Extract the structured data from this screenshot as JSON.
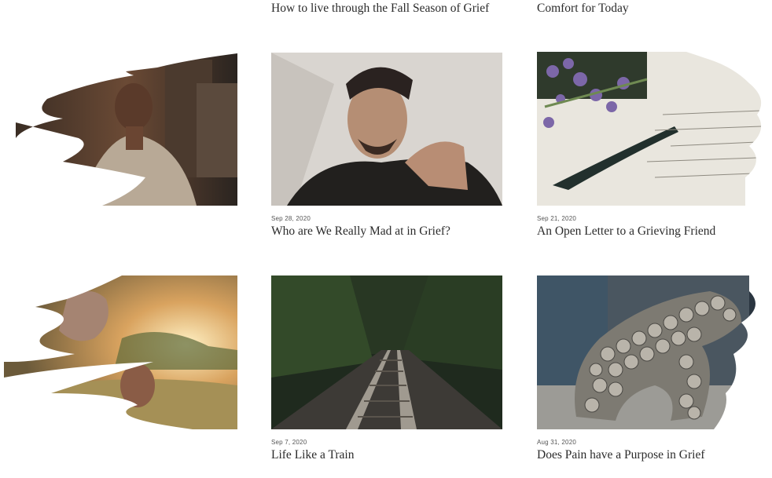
{
  "top_row": {
    "post_2_title": "How to live through the Fall Season of Grief",
    "post_3_title": "Comfort for Today"
  },
  "row_1": {
    "post_1": {
      "image_alt": "woman resting chin on hands"
    },
    "post_2": {
      "date": "Sep 28, 2020",
      "title": "Who are We Really Mad at in Grief?",
      "image_alt": "young man with shadowed face"
    },
    "post_3": {
      "date": "Sep 21, 2020",
      "title": "An Open Letter to a Grieving Friend",
      "image_alt": "fountain pen on handwritten letter with lavender"
    }
  },
  "row_2": {
    "post_1": {
      "image_alt": "person holding teddy bear in field at sunset"
    },
    "post_2": {
      "date": "Sep 7, 2020",
      "title": "Life Like a Train",
      "image_alt": "railway tracks through forest"
    },
    "post_3": {
      "date": "Aug 31, 2020",
      "title": "Does Pain have a Purpose in Grief",
      "image_alt": "stone sculpture of crouching figure"
    }
  },
  "colors": {
    "text": "#2b2b2b",
    "date": "#555555",
    "background": "#ffffff"
  }
}
